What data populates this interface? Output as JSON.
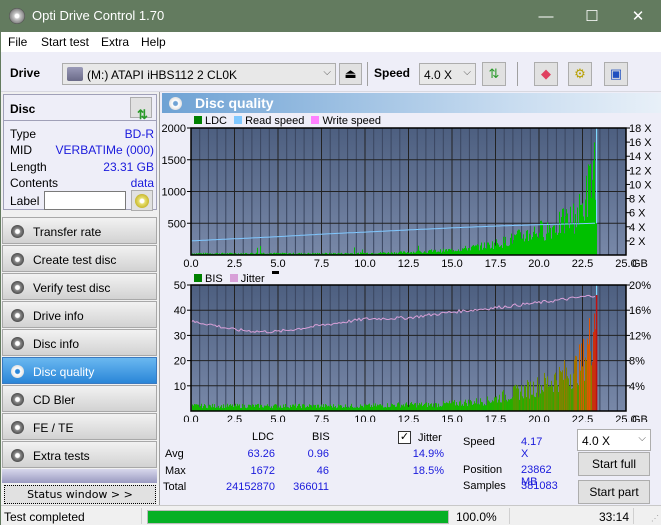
{
  "window": {
    "title": "Opti Drive Control 1.70",
    "minimize": "—",
    "maximize": "☐",
    "close": "✕"
  },
  "menu": [
    "File",
    "Start test",
    "Extra",
    "Help"
  ],
  "toolbar": {
    "drive_label": "Drive",
    "drive_value": "(M:)  ATAPI iHBS112  2 CL0K",
    "speed_label": "Speed",
    "speed_value": "4.0 X",
    "icons": [
      "eject-icon",
      "refresh-icon",
      "erase-icon",
      "settings-icon",
      "save-icon"
    ]
  },
  "disc": {
    "header": "Disc",
    "rows": [
      {
        "key": "Type",
        "value": "BD-R"
      },
      {
        "key": "MID",
        "value": "VERBATIMe (000)"
      },
      {
        "key": "Length",
        "value": "23.31 GB"
      },
      {
        "key": "Contents",
        "value": "data"
      }
    ],
    "label_key": "Label",
    "label_value": ""
  },
  "nav": [
    {
      "label": "Transfer rate",
      "active": false
    },
    {
      "label": "Create test disc",
      "active": false
    },
    {
      "label": "Verify test disc",
      "active": false
    },
    {
      "label": "Drive info",
      "active": false
    },
    {
      "label": "Disc info",
      "active": false
    },
    {
      "label": "Disc quality",
      "active": true
    },
    {
      "label": "CD Bler",
      "active": false
    },
    {
      "label": "FE / TE",
      "active": false
    },
    {
      "label": "Extra tests",
      "active": false
    }
  ],
  "status_window_button": "Status window > >",
  "panel": {
    "title": "Disc quality"
  },
  "colors": {
    "ldc": "#008000",
    "read_speed": "#80c8ff",
    "write_speed": "#ff80ff",
    "bis": "#008000",
    "jitter": "#d8a0d8",
    "plot_bg_top": "#4d5f80",
    "plot_bg_bottom": "#7888a8",
    "progress": "#06b025",
    "accent_active": "#2a86d8"
  },
  "chart_data": [
    {
      "type": "bar",
      "title": "LDC / Read speed",
      "legend": [
        "LDC",
        "Read speed",
        "Write speed"
      ],
      "legend_position": "top-left",
      "x_unit": "GB",
      "xlim": [
        0,
        25
      ],
      "x_ticks": [
        "0.0",
        "2.5",
        "5.0",
        "7.5",
        "10.0",
        "12.5",
        "15.0",
        "17.5",
        "20.0",
        "22.5",
        "25.0"
      ],
      "ylim": [
        0,
        2000
      ],
      "y_ticks": [
        "500",
        "1000",
        "1500",
        "2000"
      ],
      "y2lim": [
        0,
        18
      ],
      "y2_ticks": [
        "2 X",
        "4 X",
        "6 X",
        "8 X",
        "10 X",
        "12 X",
        "14 X",
        "16 X",
        "18 X"
      ],
      "grid": true,
      "series": [
        {
          "name": "LDC",
          "x": [
            0,
            1,
            2,
            3,
            4,
            5,
            6,
            7,
            8,
            9,
            10,
            11,
            12,
            13,
            14,
            15,
            16,
            17,
            18,
            19,
            20,
            21,
            22,
            22.5,
            23,
            23.31
          ],
          "values": [
            25,
            25,
            25,
            25,
            30,
            25,
            25,
            25,
            25,
            25,
            30,
            35,
            40,
            50,
            60,
            80,
            110,
            150,
            210,
            300,
            380,
            460,
            600,
            750,
            1200,
            1672
          ]
        },
        {
          "name": "Read speed",
          "x": [
            0,
            2.5,
            5,
            7.5,
            10,
            12.5,
            15,
            17.5,
            20,
            22.5,
            23.31
          ],
          "values": [
            2.0,
            2.3,
            2.6,
            2.95,
            3.25,
            3.55,
            3.85,
            4.1,
            4.3,
            4.45,
            4.5
          ]
        }
      ]
    },
    {
      "type": "bar",
      "title": "BIS / Jitter",
      "legend": [
        "BIS",
        "Jitter"
      ],
      "legend_position": "top-left",
      "x_unit": "GB",
      "xlim": [
        0,
        25
      ],
      "x_ticks": [
        "0.0",
        "2.5",
        "5.0",
        "7.5",
        "10.0",
        "12.5",
        "15.0",
        "17.5",
        "20.0",
        "22.5",
        "25.0"
      ],
      "ylim": [
        0,
        50
      ],
      "y_ticks": [
        "10",
        "20",
        "30",
        "40",
        "50"
      ],
      "y2lim": [
        0,
        20
      ],
      "y2_ticks": [
        "4%",
        "8%",
        "12%",
        "16%",
        "20%"
      ],
      "grid": true,
      "series": [
        {
          "name": "BIS",
          "x": [
            0,
            2,
            4,
            6,
            8,
            10,
            12,
            14,
            15,
            16,
            17,
            18,
            19,
            20,
            21,
            22,
            22.5,
            23,
            23.31
          ],
          "values": [
            2,
            2,
            2,
            2,
            2,
            2,
            2.5,
            2.5,
            3,
            3.5,
            4,
            6,
            8,
            10,
            13,
            16,
            20,
            30,
            46
          ]
        },
        {
          "name": "Jitter",
          "x": [
            0,
            1,
            2.5,
            4,
            5,
            7.5,
            10,
            12.5,
            15,
            17.5,
            20,
            22.5,
            23.31
          ],
          "values": [
            14.2,
            13.8,
            12.9,
            12.6,
            12.6,
            13.6,
            14.6,
            14.8,
            15.7,
            16.4,
            17.2,
            18.1,
            18.4
          ]
        }
      ]
    }
  ],
  "stats": {
    "col_ldc": "LDC",
    "col_bis": "BIS",
    "jitter_label": "Jitter",
    "jitter_checked": true,
    "rows": [
      {
        "label": "Avg",
        "ldc": "63.26",
        "bis": "0.96",
        "jitter": "14.9%"
      },
      {
        "label": "Max",
        "ldc": "1672",
        "bis": "46",
        "jitter": "18.5%"
      },
      {
        "label": "Total",
        "ldc": "24152870",
        "bis": "366011",
        "jitter": ""
      }
    ],
    "speed_label": "Speed",
    "speed_value": "4.17 X",
    "position_label": "Position",
    "position_value": "23862 MB",
    "samples_label": "Samples",
    "samples_value": "381083",
    "speed_select": "4.0 X",
    "start_full": "Start full",
    "start_part": "Start part"
  },
  "statusbar": {
    "text": "Test completed",
    "progress": 100.0,
    "progress_text": "100.0%",
    "time": "33:14"
  }
}
